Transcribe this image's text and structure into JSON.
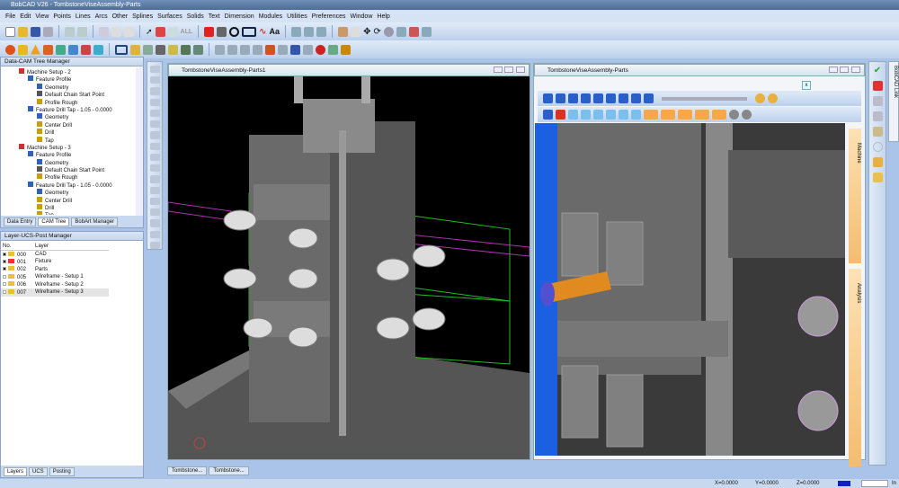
{
  "app": {
    "title": "BobCAD V26 - TombstoneViseAssembly-Parts"
  },
  "menu": [
    "File",
    "Edit",
    "View",
    "Points",
    "Lines",
    "Arcs",
    "Other",
    "Splines",
    "Surfaces",
    "Solids",
    "Text",
    "Dimension",
    "Modules",
    "Utilities",
    "Preferences",
    "Window",
    "Help"
  ],
  "toolbar": {
    "all_label": "ALL",
    "text_label": "Aa"
  },
  "cam_tree": {
    "title": "Data-CAM Tree Manager",
    "items": [
      {
        "label": "Machine Setup - 2",
        "level": 1,
        "color": "#d03030"
      },
      {
        "label": "Feature Profile",
        "level": 2,
        "color": "#3060c0"
      },
      {
        "label": "Geometry",
        "level": 3,
        "color": "#3060c0"
      },
      {
        "label": "Default Chain Start Point",
        "level": 3,
        "color": "#555"
      },
      {
        "label": "Profile Rough",
        "level": 3,
        "color": "#c8a000"
      },
      {
        "label": "Feature Drill Tap - 1.05 - 0.0000",
        "level": 2,
        "color": "#3060c0"
      },
      {
        "label": "Geometry",
        "level": 3,
        "color": "#3060c0"
      },
      {
        "label": "Center Drill",
        "level": 3,
        "color": "#c8a000"
      },
      {
        "label": "Drill",
        "level": 3,
        "color": "#c8a000"
      },
      {
        "label": "Tap",
        "level": 3,
        "color": "#c8a000"
      },
      {
        "label": "Machine Setup - 3",
        "level": 1,
        "color": "#d03030"
      },
      {
        "label": "Feature Profile",
        "level": 2,
        "color": "#3060c0"
      },
      {
        "label": "Geometry",
        "level": 3,
        "color": "#3060c0"
      },
      {
        "label": "Default Chain Start Point",
        "level": 3,
        "color": "#555"
      },
      {
        "label": "Profile Rough",
        "level": 3,
        "color": "#c8a000"
      },
      {
        "label": "Feature Drill Tap - 1.05 - 0.0000",
        "level": 2,
        "color": "#3060c0"
      },
      {
        "label": "Geometry",
        "level": 3,
        "color": "#3060c0"
      },
      {
        "label": "Center Drill",
        "level": 3,
        "color": "#c8a000"
      },
      {
        "label": "Drill",
        "level": 3,
        "color": "#c8a000"
      },
      {
        "label": "Tap",
        "level": 3,
        "color": "#c8a000"
      }
    ],
    "tabs": [
      "Data Entry",
      "CAM Tree",
      "BobArt Manager"
    ],
    "active_tab": 1
  },
  "layer_manager": {
    "title": "Layer-UCS-Post Manager",
    "columns": [
      "No.",
      "Layer"
    ],
    "rows": [
      {
        "no": "000",
        "name": "CAD",
        "visible": true,
        "current": false
      },
      {
        "no": "001",
        "name": "Fixture",
        "visible": true,
        "current": true
      },
      {
        "no": "002",
        "name": "Parts",
        "visible": true,
        "current": false
      },
      {
        "no": "005",
        "name": "Wireframe - Setup 1",
        "visible": false,
        "current": false
      },
      {
        "no": "006",
        "name": "Wireframe - Setup 2",
        "visible": false,
        "current": false
      },
      {
        "no": "007",
        "name": "Wireframe - Setup 3",
        "visible": false,
        "current": false
      }
    ],
    "tabs": [
      "Layers",
      "UCS",
      "Posting"
    ],
    "active_tab": 0
  },
  "viewports": [
    {
      "title": "TombstoneViseAssembly-Parts1"
    },
    {
      "title": "TombstoneViseAssembly-Parts",
      "close_label": "x"
    }
  ],
  "side_tabs": [
    "Machine",
    "Analysis"
  ],
  "right_link": "BobCAD Link",
  "doc_tabs": [
    "Tombstone...",
    "Tombstone..."
  ],
  "status": {
    "x": "X=0.0000",
    "y": "Y=0.0000",
    "z": "Z=0.0000",
    "unit": "In"
  },
  "colors": {
    "accent": "#4d6d98",
    "simulation_highlight": "#f7a84a",
    "current_color": "#1020c0"
  }
}
